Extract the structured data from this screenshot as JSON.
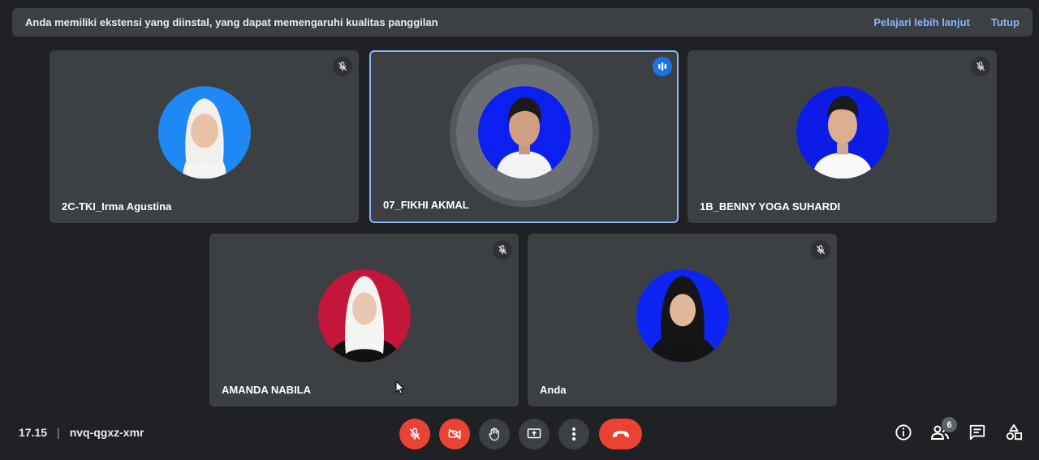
{
  "banner": {
    "message": "Anda memiliki ekstensi yang diinstal, yang dapat memengaruhi kualitas panggilan",
    "learn_more": "Pelajari lebih lanjut",
    "close": "Tutup"
  },
  "participants": [
    {
      "name": "2C-TKI_Irma Agustina",
      "muted": true,
      "bg": "#1e88f5"
    },
    {
      "name": "07_FIKHI AKMAL",
      "speaking": true,
      "bg": "#0b1ff0"
    },
    {
      "name": "1B_BENNY YOGA SUHARDI",
      "muted": true,
      "bg": "#0c1ce6"
    },
    {
      "name": "AMANDA NABILA",
      "muted": true,
      "bg": "#c4153a"
    },
    {
      "name": "Anda",
      "muted": true,
      "bg": "#0d24f2"
    }
  ],
  "meeting": {
    "time": "17.15",
    "code": "nvq-qgxz-xmr"
  },
  "controls": {
    "mic": "mic-off-icon",
    "camera": "camera-off-icon",
    "raise_hand": "hand-icon",
    "present": "present-icon",
    "more": "more-vert-icon",
    "leave": "call-end-icon"
  },
  "right_panel": {
    "people_count": "6"
  },
  "colors": {
    "background": "#202124",
    "tile": "#3c4043",
    "accent": "#8ab4f8",
    "danger": "#ea4335"
  }
}
